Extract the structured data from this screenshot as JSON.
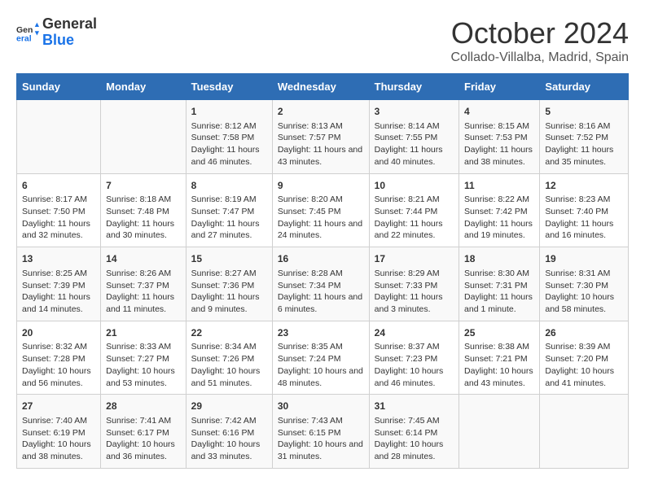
{
  "header": {
    "logo_text_general": "General",
    "logo_text_blue": "Blue",
    "title": "October 2024",
    "subtitle": "Collado-Villalba, Madrid, Spain"
  },
  "days_of_week": [
    "Sunday",
    "Monday",
    "Tuesday",
    "Wednesday",
    "Thursday",
    "Friday",
    "Saturday"
  ],
  "weeks": [
    [
      {
        "day": "",
        "sunrise": "",
        "sunset": "",
        "daylight": ""
      },
      {
        "day": "",
        "sunrise": "",
        "sunset": "",
        "daylight": ""
      },
      {
        "day": "1",
        "sunrise": "Sunrise: 8:12 AM",
        "sunset": "Sunset: 7:58 PM",
        "daylight": "Daylight: 11 hours and 46 minutes."
      },
      {
        "day": "2",
        "sunrise": "Sunrise: 8:13 AM",
        "sunset": "Sunset: 7:57 PM",
        "daylight": "Daylight: 11 hours and 43 minutes."
      },
      {
        "day": "3",
        "sunrise": "Sunrise: 8:14 AM",
        "sunset": "Sunset: 7:55 PM",
        "daylight": "Daylight: 11 hours and 40 minutes."
      },
      {
        "day": "4",
        "sunrise": "Sunrise: 8:15 AM",
        "sunset": "Sunset: 7:53 PM",
        "daylight": "Daylight: 11 hours and 38 minutes."
      },
      {
        "day": "5",
        "sunrise": "Sunrise: 8:16 AM",
        "sunset": "Sunset: 7:52 PM",
        "daylight": "Daylight: 11 hours and 35 minutes."
      }
    ],
    [
      {
        "day": "6",
        "sunrise": "Sunrise: 8:17 AM",
        "sunset": "Sunset: 7:50 PM",
        "daylight": "Daylight: 11 hours and 32 minutes."
      },
      {
        "day": "7",
        "sunrise": "Sunrise: 8:18 AM",
        "sunset": "Sunset: 7:48 PM",
        "daylight": "Daylight: 11 hours and 30 minutes."
      },
      {
        "day": "8",
        "sunrise": "Sunrise: 8:19 AM",
        "sunset": "Sunset: 7:47 PM",
        "daylight": "Daylight: 11 hours and 27 minutes."
      },
      {
        "day": "9",
        "sunrise": "Sunrise: 8:20 AM",
        "sunset": "Sunset: 7:45 PM",
        "daylight": "Daylight: 11 hours and 24 minutes."
      },
      {
        "day": "10",
        "sunrise": "Sunrise: 8:21 AM",
        "sunset": "Sunset: 7:44 PM",
        "daylight": "Daylight: 11 hours and 22 minutes."
      },
      {
        "day": "11",
        "sunrise": "Sunrise: 8:22 AM",
        "sunset": "Sunset: 7:42 PM",
        "daylight": "Daylight: 11 hours and 19 minutes."
      },
      {
        "day": "12",
        "sunrise": "Sunrise: 8:23 AM",
        "sunset": "Sunset: 7:40 PM",
        "daylight": "Daylight: 11 hours and 16 minutes."
      }
    ],
    [
      {
        "day": "13",
        "sunrise": "Sunrise: 8:25 AM",
        "sunset": "Sunset: 7:39 PM",
        "daylight": "Daylight: 11 hours and 14 minutes."
      },
      {
        "day": "14",
        "sunrise": "Sunrise: 8:26 AM",
        "sunset": "Sunset: 7:37 PM",
        "daylight": "Daylight: 11 hours and 11 minutes."
      },
      {
        "day": "15",
        "sunrise": "Sunrise: 8:27 AM",
        "sunset": "Sunset: 7:36 PM",
        "daylight": "Daylight: 11 hours and 9 minutes."
      },
      {
        "day": "16",
        "sunrise": "Sunrise: 8:28 AM",
        "sunset": "Sunset: 7:34 PM",
        "daylight": "Daylight: 11 hours and 6 minutes."
      },
      {
        "day": "17",
        "sunrise": "Sunrise: 8:29 AM",
        "sunset": "Sunset: 7:33 PM",
        "daylight": "Daylight: 11 hours and 3 minutes."
      },
      {
        "day": "18",
        "sunrise": "Sunrise: 8:30 AM",
        "sunset": "Sunset: 7:31 PM",
        "daylight": "Daylight: 11 hours and 1 minute."
      },
      {
        "day": "19",
        "sunrise": "Sunrise: 8:31 AM",
        "sunset": "Sunset: 7:30 PM",
        "daylight": "Daylight: 10 hours and 58 minutes."
      }
    ],
    [
      {
        "day": "20",
        "sunrise": "Sunrise: 8:32 AM",
        "sunset": "Sunset: 7:28 PM",
        "daylight": "Daylight: 10 hours and 56 minutes."
      },
      {
        "day": "21",
        "sunrise": "Sunrise: 8:33 AM",
        "sunset": "Sunset: 7:27 PM",
        "daylight": "Daylight: 10 hours and 53 minutes."
      },
      {
        "day": "22",
        "sunrise": "Sunrise: 8:34 AM",
        "sunset": "Sunset: 7:26 PM",
        "daylight": "Daylight: 10 hours and 51 minutes."
      },
      {
        "day": "23",
        "sunrise": "Sunrise: 8:35 AM",
        "sunset": "Sunset: 7:24 PM",
        "daylight": "Daylight: 10 hours and 48 minutes."
      },
      {
        "day": "24",
        "sunrise": "Sunrise: 8:37 AM",
        "sunset": "Sunset: 7:23 PM",
        "daylight": "Daylight: 10 hours and 46 minutes."
      },
      {
        "day": "25",
        "sunrise": "Sunrise: 8:38 AM",
        "sunset": "Sunset: 7:21 PM",
        "daylight": "Daylight: 10 hours and 43 minutes."
      },
      {
        "day": "26",
        "sunrise": "Sunrise: 8:39 AM",
        "sunset": "Sunset: 7:20 PM",
        "daylight": "Daylight: 10 hours and 41 minutes."
      }
    ],
    [
      {
        "day": "27",
        "sunrise": "Sunrise: 7:40 AM",
        "sunset": "Sunset: 6:19 PM",
        "daylight": "Daylight: 10 hours and 38 minutes."
      },
      {
        "day": "28",
        "sunrise": "Sunrise: 7:41 AM",
        "sunset": "Sunset: 6:17 PM",
        "daylight": "Daylight: 10 hours and 36 minutes."
      },
      {
        "day": "29",
        "sunrise": "Sunrise: 7:42 AM",
        "sunset": "Sunset: 6:16 PM",
        "daylight": "Daylight: 10 hours and 33 minutes."
      },
      {
        "day": "30",
        "sunrise": "Sunrise: 7:43 AM",
        "sunset": "Sunset: 6:15 PM",
        "daylight": "Daylight: 10 hours and 31 minutes."
      },
      {
        "day": "31",
        "sunrise": "Sunrise: 7:45 AM",
        "sunset": "Sunset: 6:14 PM",
        "daylight": "Daylight: 10 hours and 28 minutes."
      },
      {
        "day": "",
        "sunrise": "",
        "sunset": "",
        "daylight": ""
      },
      {
        "day": "",
        "sunrise": "",
        "sunset": "",
        "daylight": ""
      }
    ]
  ]
}
